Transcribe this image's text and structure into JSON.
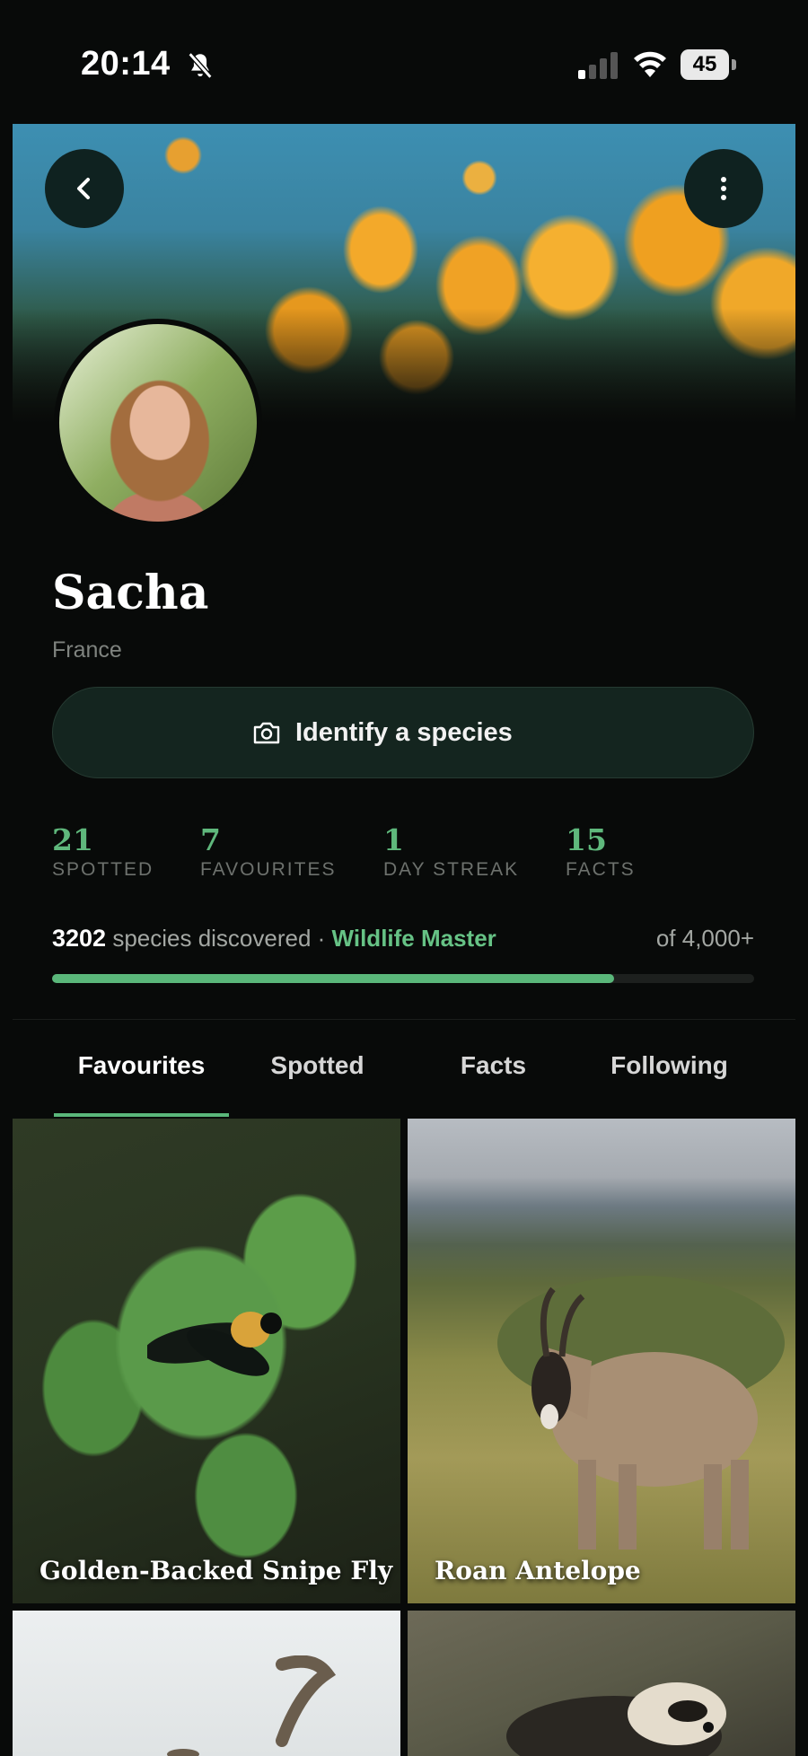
{
  "status_bar": {
    "time": "20:14",
    "battery": "45"
  },
  "profile": {
    "name": "Sacha",
    "country": "France",
    "identify_label": "Identify a species"
  },
  "stats": [
    {
      "value": "21",
      "label": "SPOTTED"
    },
    {
      "value": "7",
      "label": "FAVOURITES"
    },
    {
      "value": "1",
      "label": "DAY STREAK"
    },
    {
      "value": "15",
      "label": "FACTS"
    }
  ],
  "progress": {
    "count": "3202",
    "text": "species discovered ·",
    "level": "Wildlife Master",
    "of": "of 4,000+",
    "fraction": 0.8
  },
  "tabs": [
    {
      "label": "Favourites",
      "active": true
    },
    {
      "label": "Spotted",
      "active": false
    },
    {
      "label": "Facts",
      "active": false
    },
    {
      "label": "Following",
      "active": false
    }
  ],
  "grid": [
    {
      "caption": "Golden-Backed Snipe Fly"
    },
    {
      "caption": "Roan Antelope"
    },
    {
      "caption": ""
    },
    {
      "caption": ""
    }
  ],
  "colors": {
    "accent": "#5ab77a",
    "background": "#080a09"
  }
}
